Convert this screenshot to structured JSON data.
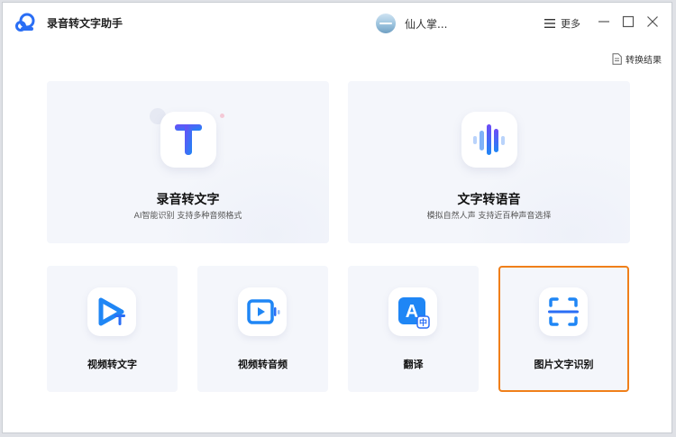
{
  "app": {
    "title": "录音转文字助手"
  },
  "user": {
    "name": "仙人掌..."
  },
  "toolbar": {
    "more_label": "更多",
    "result_label": "转换结果"
  },
  "features": {
    "record_to_text": {
      "title": "录音转文字",
      "subtitle": "AI智能识别 支持多种音频格式",
      "icon": "letter-t-icon"
    },
    "text_to_speech": {
      "title": "文字转语音",
      "subtitle": "模拟自然人声 支持近百种声音选择",
      "icon": "sound-wave-icon"
    },
    "video_to_text": {
      "title": "视频转文字",
      "icon": "video-play-t-icon"
    },
    "video_to_audio": {
      "title": "视频转音频",
      "icon": "video-screen-wave-icon"
    },
    "translate": {
      "title": "翻译",
      "icon": "translate-a-zh-icon"
    },
    "image_ocr": {
      "title": "图片文字识别",
      "icon": "scan-frame-icon",
      "selected": true
    }
  },
  "colors": {
    "accent_blue": "#2a6ef5",
    "selection_orange": "#f07f1a",
    "card_bg": "#f4f6fb"
  }
}
